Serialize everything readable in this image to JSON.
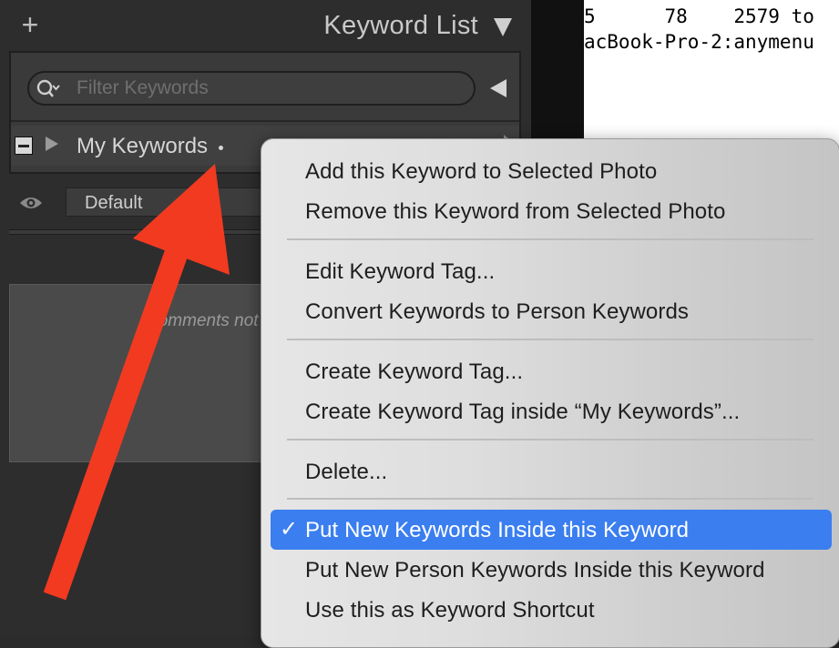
{
  "panel": {
    "add_symbol": "+",
    "title": "Keyword List",
    "filter_placeholder": "Filter Keywords",
    "keyword_row": {
      "label": "My Keywords"
    },
    "default_select": "Default",
    "comments_text": "Comments not"
  },
  "terminal": {
    "line1": "5      78    2579 to",
    "line2": "acBook-Pro-2:anymenu"
  },
  "context_menu": {
    "items": [
      "Add this Keyword to Selected Photo",
      "Remove this Keyword from Selected Photo",
      "Edit Keyword Tag...",
      "Convert Keywords to Person Keywords",
      "Create Keyword Tag...",
      "Create Keyword Tag inside “My Keywords”...",
      "Delete...",
      "Put New Keywords Inside this Keyword",
      "Put New Person Keywords Inside this Keyword",
      "Use this as Keyword Shortcut"
    ],
    "checked_symbol": "✓"
  },
  "colors": {
    "panel_bg": "#2d2d2d",
    "menu_highlight": "#3a7ef0",
    "arrow": "#f23a21"
  }
}
